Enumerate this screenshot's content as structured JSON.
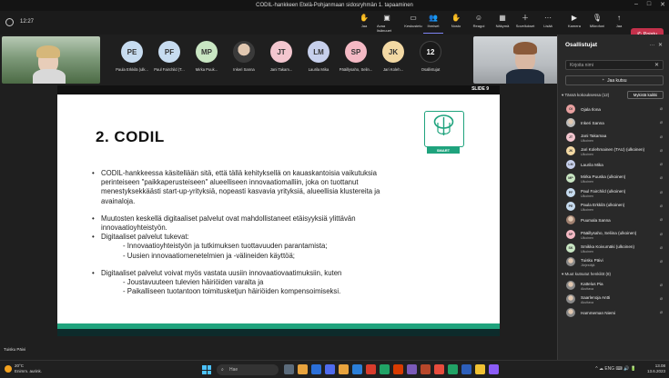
{
  "window": {
    "title": "CODIL-hankkeen Etelä-Pohjanmaan sidosryhmän 1. tapaaminen",
    "controls": [
      "–",
      "□",
      "✕"
    ]
  },
  "toolbar": {
    "time": "12:27",
    "buttons": [
      {
        "label": "Jaa",
        "icon": "✋"
      },
      {
        "label": "Avaa lisänuuet",
        "icon": "▣"
      },
      {
        "label": "Keskustelu",
        "icon": "▭"
      },
      {
        "label": "Ihmiset",
        "icon": "👥"
      },
      {
        "label": "Nosto",
        "icon": "✋"
      },
      {
        "label": "Reagoi",
        "icon": "☺"
      },
      {
        "label": "Näkymä",
        "icon": "▦"
      },
      {
        "label": "Sovellukset",
        "icon": "＋"
      },
      {
        "label": "Lisää",
        "icon": "···"
      },
      {
        "label": "Kamera",
        "icon": "▶"
      },
      {
        "label": "Mikrofoni",
        "icon": "🎙"
      },
      {
        "label": "Jaa",
        "icon": "↑"
      }
    ],
    "leave_label": "Poistu"
  },
  "participants_strip": [
    {
      "initials": "PE",
      "name": "Paula Erkkilä (ulk...",
      "color": "#c7dcf0"
    },
    {
      "initials": "PF",
      "name": "Paul Fairchild (T...",
      "color": "#c7dcf0"
    },
    {
      "initials": "MP",
      "name": "Mirka Puuk...",
      "color": "#c9e6c3"
    },
    {
      "initials": "",
      "name": "Inkeri Sanna",
      "color": "#6b6b6b"
    },
    {
      "initials": "JT",
      "name": "Jani Takam...",
      "color": "#f3c6cf"
    },
    {
      "initials": "LM",
      "name": "Laurila Mika",
      "color": "#c7d0ec"
    },
    {
      "initials": "SP",
      "name": "Pääillysaho, Selin...",
      "color": "#f4b9c4"
    },
    {
      "initials": "JK",
      "name": "Jari Koleh...",
      "color": "#f3d9a4"
    },
    {
      "initials": "12",
      "name": "Osallistujat",
      "color": "#1a1a1a"
    }
  ],
  "slide": {
    "number": "SLIDE 9",
    "title": "2. CODIL",
    "logo_label": "SMART",
    "bullets": [
      {
        "type": "bullet",
        "text": "CODIL-hankkeessa käsitellään sitä, että tällä kehityksellä on kauaskantoisia vaikutuksia"
      },
      {
        "type": "cont",
        "text": "perinteiseen \"paikkaperusteiseen\" alueelliseen innovaatiomalliin, joka on tuottanut"
      },
      {
        "type": "cont",
        "text": "menestyksekkäästi start-up-yrityksiä, nopeasti kasvavia yrityksiä, alueellisia klustereita ja"
      },
      {
        "type": "cont",
        "text": "avainaloja."
      },
      {
        "type": "gap"
      },
      {
        "type": "bullet",
        "text": "Muutosten keskellä digitaaliset palvelut ovat mahdollistaneet etäisyyksiä ylittävän"
      },
      {
        "type": "cont",
        "text": "innovaatioyhteistyön."
      },
      {
        "type": "bullet",
        "text": "Digitaaliset palvelut tukevat:"
      },
      {
        "type": "sub",
        "text": "- Innovaatioyhteistyön ja tutkimuksen tuottavuuden parantamista;"
      },
      {
        "type": "sub",
        "text": "- Uusien innovaatiomenetelmien ja -välineiden käyttöä;"
      },
      {
        "type": "gap"
      },
      {
        "type": "bullet",
        "text": "Digitaaliset palvelut voivat myös vastata uusiin innovaatiovaatimuksiin, kuten"
      },
      {
        "type": "sub",
        "text": "- Joustavuuteen tulevien häiriöiden varalta ja"
      },
      {
        "type": "sub",
        "text": "- Paikalliseen tuotantoon toimitusketjun häiriöiden kompensoimiseksi."
      }
    ]
  },
  "speaker_label": "Tuisku Päivi",
  "panel": {
    "title": "Osallistujat",
    "search_placeholder": "Kirjoita nimi",
    "invite_label": "Jaa kutsu",
    "section_in_meeting": "Tässä kokouksessa (12)",
    "mute_all": "Mykistä kaikki",
    "people": [
      {
        "initials": "OI",
        "name": "Ojala Ilona",
        "sub": "",
        "color": "#e8a0a0"
      },
      {
        "initials": "",
        "name": "Inkeri Sanna",
        "sub": "",
        "color": "#bbbbbb"
      },
      {
        "initials": "JT",
        "name": "Jani Takamaa",
        "sub": "Ulkoinen",
        "color": "#f3c6cf"
      },
      {
        "initials": "JK",
        "name": "Jari Kolehmainen (TAU) (ulkoinen)",
        "sub": "Ulkoinen",
        "color": "#f3d9a4"
      },
      {
        "initials": "LM",
        "name": "Laurila Mika",
        "sub": "",
        "color": "#c7d0ec"
      },
      {
        "initials": "MP",
        "name": "Mirka Puuska (ulkoinen)",
        "sub": "Ulkoinen",
        "color": "#c9e6c3"
      },
      {
        "initials": "PF",
        "name": "Paul Fairchild (ulkoinen)",
        "sub": "Ulkoinen",
        "color": "#c7dcf0"
      },
      {
        "initials": "PE",
        "name": "Paula Erkkilä (ulkoinen)",
        "sub": "Ulkoinen",
        "color": "#c7dcf0"
      },
      {
        "initials": "",
        "name": "Puumala Sanna",
        "sub": "",
        "color": "#a08070"
      },
      {
        "initials": "SP",
        "name": "Pääillysaho, Seliina (ulkoinen)",
        "sub": "Ulkoinen",
        "color": "#f4b9c4"
      },
      {
        "initials": "SK",
        "name": "Smikka Koivumäki (ulkoinen)",
        "sub": "Ulkoinen",
        "color": "#c9e6c3"
      },
      {
        "initials": "",
        "name": "Tuisku Päivi",
        "sub": "Järjestäjä",
        "color": "#8a8a8a"
      }
    ],
    "section_others": "Muut kutsutut henkilöt (8)",
    "others": [
      {
        "initials": "",
        "name": "Kattelus Pia",
        "sub": "Akuttava",
        "color": "#8a8a8a"
      },
      {
        "initials": "",
        "name": "Saarlenoja Antti",
        "sub": "Akuttava",
        "color": "#8a8a8a"
      },
      {
        "initials": "",
        "name": "Hammeman Niemi",
        "sub": "",
        "color": "#8a8a8a"
      }
    ]
  },
  "taskbar": {
    "temp": "20°C",
    "weather": "Enimm. aurink.",
    "search_placeholder": "Hae",
    "time": "13.08",
    "date": "13.6.2023",
    "tray": "^ ☁ ENG ⌨ 🔊 🔋",
    "app_colors": [
      "#5b6b7b",
      "#e8a33d",
      "#2b6fd8",
      "#4f6bed",
      "#e8a33d",
      "#2b7fd8",
      "#d93c2c",
      "#21a366",
      "#d83b01",
      "#7a5ab8",
      "#b7472a",
      "#e84c3d",
      "#21a366",
      "#2d5fba",
      "#f1c232",
      "#8b5cf6"
    ]
  }
}
